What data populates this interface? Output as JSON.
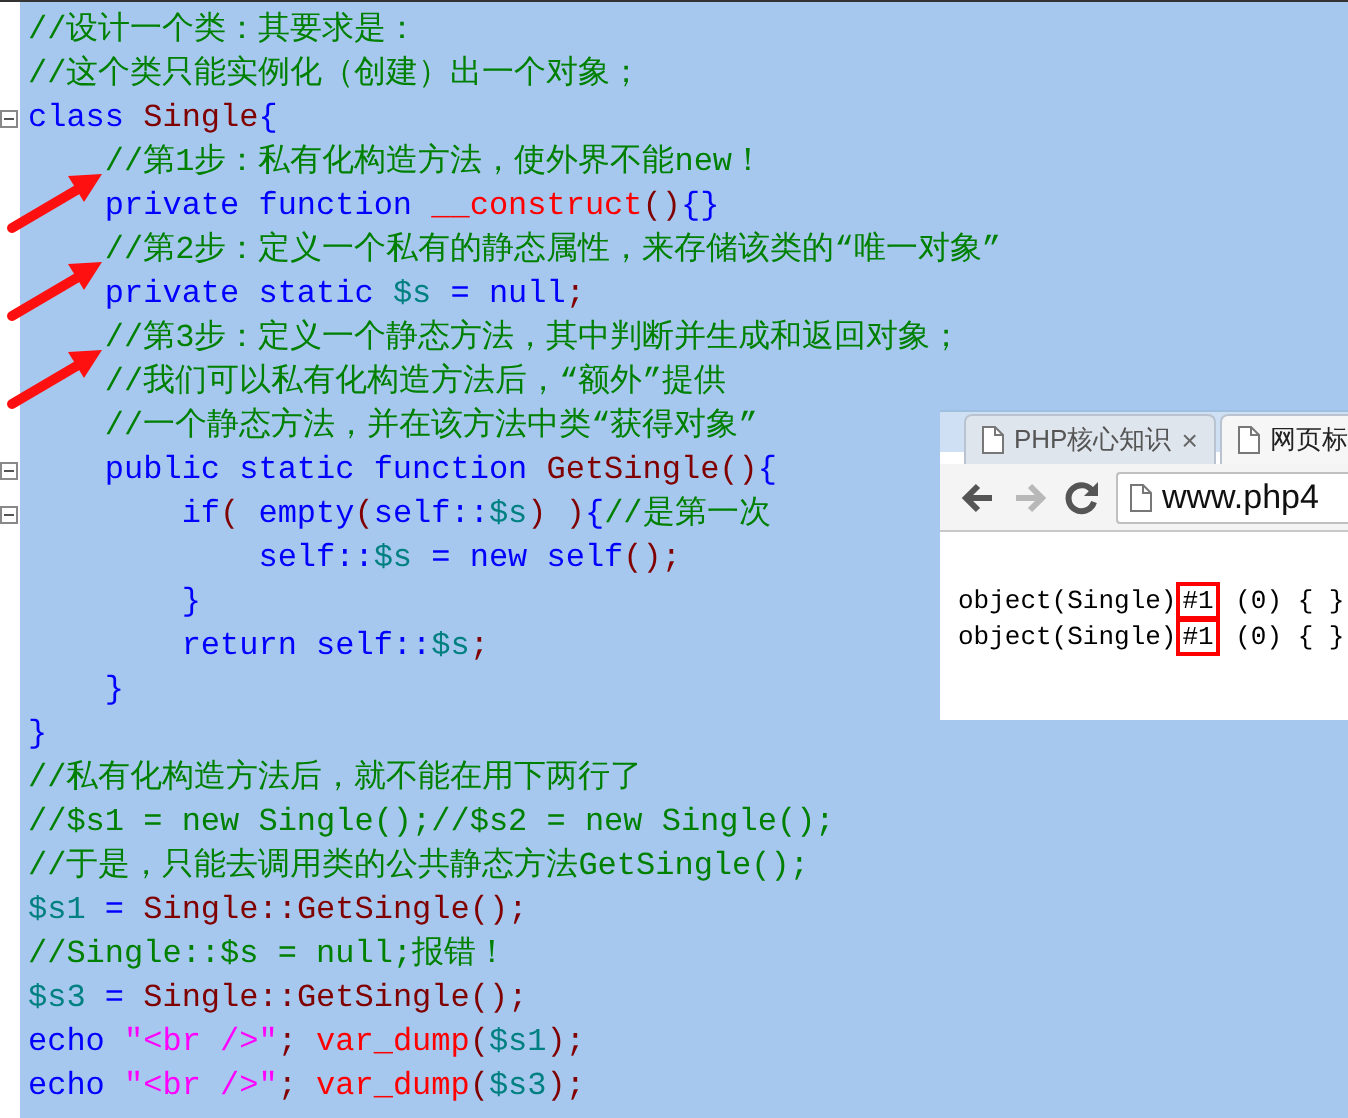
{
  "editor": {
    "lines": [
      {
        "tokens": [
          {
            "kind": "comment",
            "text": "//设计一个类：其要求是："
          }
        ]
      },
      {
        "tokens": [
          {
            "kind": "comment",
            "text": "//这个类只能实例化（创建）出一个对象；"
          }
        ]
      },
      {
        "fold": true,
        "tokens": [
          {
            "kind": "keyword",
            "text": "class "
          },
          {
            "kind": "name",
            "text": "Single"
          },
          {
            "kind": "keyword",
            "text": "{"
          }
        ]
      },
      {
        "arrow": true,
        "tokens": [
          {
            "kind": "comment",
            "text": "    //第1步：私有化构造方法，使外界不能new！"
          }
        ]
      },
      {
        "tokens": [
          {
            "kind": "keyword",
            "text": "    private function "
          },
          {
            "kind": "function",
            "text": "__construct"
          },
          {
            "kind": "punct",
            "text": "()"
          },
          {
            "kind": "keyword",
            "text": "{}"
          }
        ]
      },
      {
        "arrow": true,
        "tokens": [
          {
            "kind": "comment",
            "text": "    //第2步：定义一个私有的静态属性，来存储该类的“唯一对象”"
          }
        ]
      },
      {
        "tokens": [
          {
            "kind": "keyword",
            "text": "    private static "
          },
          {
            "kind": "variable",
            "text": "$s"
          },
          {
            "kind": "keyword",
            "text": " = null"
          },
          {
            "kind": "punct",
            "text": ";"
          }
        ]
      },
      {
        "arrow": true,
        "tokens": [
          {
            "kind": "comment",
            "text": "    //第3步：定义一个静态方法，其中判断并生成和返回对象；"
          }
        ]
      },
      {
        "tokens": [
          {
            "kind": "comment",
            "text": "    //我们可以私有化构造方法后，“额外”提供"
          }
        ]
      },
      {
        "tokens": [
          {
            "kind": "comment",
            "text": "    //一个静态方法，并在该方法中类“获得对象”"
          }
        ]
      },
      {
        "fold": true,
        "tokens": [
          {
            "kind": "keyword",
            "text": "    public static function "
          },
          {
            "kind": "name",
            "text": "GetSingle"
          },
          {
            "kind": "punct",
            "text": "()"
          },
          {
            "kind": "keyword",
            "text": "{"
          }
        ]
      },
      {
        "fold": true,
        "tokens": [
          {
            "kind": "keyword",
            "text": "        if"
          },
          {
            "kind": "punct",
            "text": "("
          },
          {
            "kind": "keyword",
            "text": " empty"
          },
          {
            "kind": "punct",
            "text": "("
          },
          {
            "kind": "keyword",
            "text": "self::"
          },
          {
            "kind": "variable",
            "text": "$s"
          },
          {
            "kind": "punct",
            "text": ") )"
          },
          {
            "kind": "keyword",
            "text": "{"
          },
          {
            "kind": "comment",
            "text": "//是第一次"
          }
        ]
      },
      {
        "tokens": [
          {
            "kind": "keyword",
            "text": "            self::"
          },
          {
            "kind": "variable",
            "text": "$s"
          },
          {
            "kind": "keyword",
            "text": " = new self"
          },
          {
            "kind": "punct",
            "text": "();"
          }
        ]
      },
      {
        "tokens": [
          {
            "kind": "keyword",
            "text": "        }"
          }
        ]
      },
      {
        "tokens": [
          {
            "kind": "keyword",
            "text": "        return self::"
          },
          {
            "kind": "variable",
            "text": "$s"
          },
          {
            "kind": "punct",
            "text": ";"
          }
        ]
      },
      {
        "tokens": [
          {
            "kind": "keyword",
            "text": "    }"
          }
        ]
      },
      {
        "tokens": [
          {
            "kind": "keyword",
            "text": "}"
          }
        ]
      },
      {
        "tokens": [
          {
            "kind": "comment",
            "text": "//私有化构造方法后，就不能在用下两行了"
          }
        ]
      },
      {
        "tokens": [
          {
            "kind": "comment",
            "text": "//$s1 = new Single();//$s2 = new Single();"
          }
        ]
      },
      {
        "tokens": [
          {
            "kind": "comment",
            "text": "//于是，只能去调用类的公共静态方法GetSingle();"
          }
        ]
      },
      {
        "tokens": [
          {
            "kind": "variable",
            "text": "$s1"
          },
          {
            "kind": "keyword",
            "text": " = "
          },
          {
            "kind": "name",
            "text": "Single::GetSingle"
          },
          {
            "kind": "punct",
            "text": "();"
          }
        ]
      },
      {
        "tokens": [
          {
            "kind": "comment",
            "text": "//Single::$s = null;报错！"
          }
        ]
      },
      {
        "tokens": [
          {
            "kind": "variable",
            "text": "$s3"
          },
          {
            "kind": "keyword",
            "text": " = "
          },
          {
            "kind": "name",
            "text": "Single::GetSingle"
          },
          {
            "kind": "punct",
            "text": "();"
          }
        ]
      },
      {
        "tokens": [
          {
            "kind": "keyword",
            "text": "echo "
          },
          {
            "kind": "string",
            "text": "\"<br />\""
          },
          {
            "kind": "punct",
            "text": "; "
          },
          {
            "kind": "function",
            "text": "var_dump"
          },
          {
            "kind": "punct",
            "text": "("
          },
          {
            "kind": "variable",
            "text": "$s1"
          },
          {
            "kind": "punct",
            "text": ");"
          }
        ]
      },
      {
        "tokens": [
          {
            "kind": "keyword",
            "text": "echo "
          },
          {
            "kind": "string",
            "text": "\"<br />\""
          },
          {
            "kind": "punct",
            "text": "; "
          },
          {
            "kind": "function",
            "text": "var_dump"
          },
          {
            "kind": "punct",
            "text": "("
          },
          {
            "kind": "variable",
            "text": "$s3"
          },
          {
            "kind": "punct",
            "text": ");"
          }
        ]
      }
    ]
  },
  "browser": {
    "tabs": [
      {
        "title": "PHP核心知识",
        "close": "×",
        "selected": false
      },
      {
        "title": "网页标",
        "selected": true
      }
    ],
    "nav": [
      {
        "kind": "back",
        "disabled": false
      },
      {
        "kind": "forward",
        "disabled": true
      },
      {
        "kind": "reload",
        "disabled": false
      }
    ],
    "address": "www.php4",
    "output": [
      {
        "text": "object(Single)",
        "highlight": "#1",
        "rest": " (0) { }"
      },
      {
        "text": "object(Single)",
        "highlight": "#1",
        "rest": " (0) { }"
      }
    ]
  }
}
